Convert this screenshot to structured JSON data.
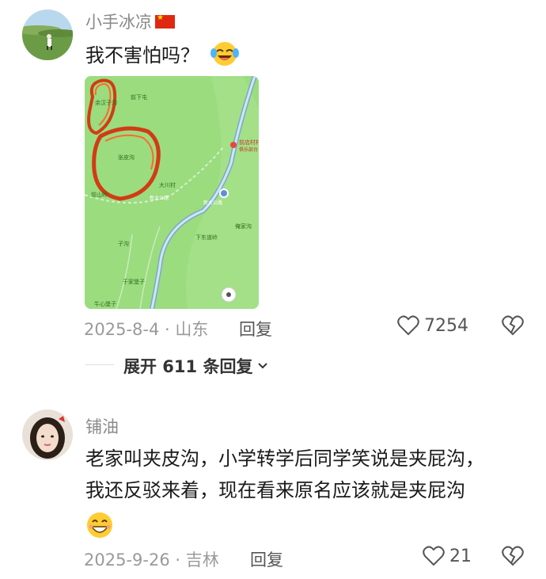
{
  "comments": [
    {
      "username": "小手冰凉",
      "text": "我不害怕吗？",
      "emoji": "crying-laughing-emoji",
      "date": "2025-8-4",
      "location": "山东",
      "reply_label": "回复",
      "likes": "7254",
      "expand_label": "展开 611 条回复",
      "map": {
        "labels": {
          "place1": "余汉子沟",
          "place2": "前下屯",
          "place3": "张皮沟",
          "place4": "大川村",
          "place5": "前山岭",
          "place6": "新太公路",
          "place7": "下东道岭",
          "place8": "俺家沟",
          "place9": "子沟",
          "place10": "于家堡子",
          "place11": "牛心堡子",
          "poi": "前店村村",
          "poi_sub": "俱乐部台",
          "road": "新太公路"
        }
      }
    },
    {
      "username": "铺油",
      "text_line1": "老家叫夹皮沟，小学转学后同学笑说是夹屁沟，",
      "text_line2": "我还反驳来着，现在看来原名应该就是夹屁沟",
      "emoji": "grinning-emoji",
      "date": "2025-9-26",
      "location": "吉林",
      "reply_label": "回复",
      "likes": "21"
    }
  ]
}
